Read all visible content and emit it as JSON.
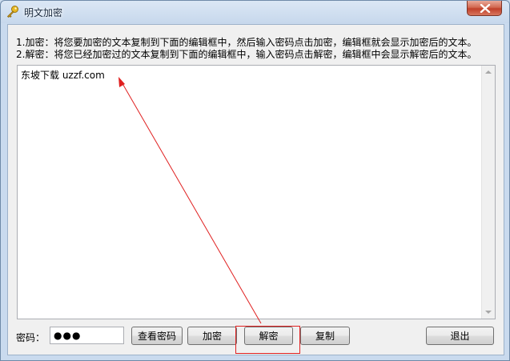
{
  "window": {
    "title": "明文加密",
    "icon": "key-icon"
  },
  "instructions": {
    "line1": "1.加密：将您要加密的文本复制到下面的编辑框中，然后输入密码点击加密，编辑框就会显示加密后的文本。",
    "line2": "2.解密：将您已经加密过的文本复制到下面的编辑框中，输入密码点击解密，编辑框中会显示解密后的文本。"
  },
  "editor": {
    "text": "东坡下载 uzzf.com"
  },
  "password": {
    "label": "密码：",
    "value": "●●●"
  },
  "buttons": {
    "view_password": "查看密码",
    "encrypt": "加密",
    "decrypt": "解密",
    "copy": "复制",
    "exit": "退出"
  },
  "annotation": {
    "color": "#e02020"
  }
}
